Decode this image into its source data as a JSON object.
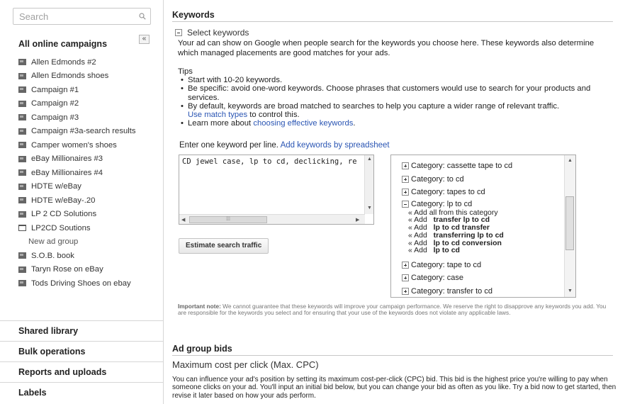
{
  "sidebar": {
    "search_placeholder": "Search",
    "all_campaigns_label": "All online campaigns",
    "collapse_label": "«",
    "campaigns": [
      "Allen Edmonds #2",
      "Allen Edmonds shoes",
      "Campaign #1",
      "Campaign #2",
      "Campaign #3",
      "Campaign #3a-search results",
      "Camper women's shoes",
      "eBay Millionaires #3",
      "eBay Millionaires #4",
      "HDTE w/eBay",
      "HDTE w/eBay-.20",
      "LP 2 CD Solutions",
      "LP2CD Soutions",
      "New ad group",
      "S.O.B. book",
      "Taryn Rose on eBay",
      "Tods Driving Shoes on ebay"
    ],
    "sections": [
      "Shared library",
      "Bulk operations",
      "Reports and uploads",
      "Labels"
    ]
  },
  "keywords": {
    "heading": "Keywords",
    "select_label": "Select keywords",
    "intro": "Your ad can show on Google when people search for the keywords you choose here. These keywords also determine which managed placements are good matches for your ads.",
    "tips_title": "Tips",
    "tip1": "Start with 10-20 keywords.",
    "tip2": "Be specific: avoid one-word keywords. Choose phrases that customers would use to search for your products and services.",
    "tip3a": "By default, keywords are broad matched to searches to help you capture a wider range of relevant traffic.",
    "tip3b_link": "Use match types",
    "tip3b_rest": " to control this.",
    "tip4_prefix": "Learn more about ",
    "tip4_link": "choosing effective keywords",
    "tip4_suffix": ".",
    "enter_prefix": "Enter one keyword per line. ",
    "enter_link": "Add keywords by spreadsheet",
    "textarea_value": "CD jewel case, lp to cd, declicking, re",
    "estimate_button": "Estimate search traffic",
    "categories": {
      "c1": "Category: cassette tape to cd",
      "c2": "Category: to cd",
      "c3": "Category: tapes to cd",
      "c4": "Category: lp to cd",
      "add_all": "« Add all from this category",
      "add1": "transfer lp to cd",
      "add2": "lp to cd transfer",
      "add3": "transferring lp to cd",
      "add4": "lp to cd conversion",
      "add5": "lp to cd",
      "add_label": "« Add",
      "c5": "Category: tape to cd",
      "c6": "Category: case",
      "c7": "Category: transfer to cd"
    },
    "important_label": "Important note:",
    "important_text": " We cannot guarantee that these keywords will improve your campaign performance. We reserve the right to disapprove any keywords you add. You are responsible for the keywords you select and for ensuring that your use of the keywords does not violate any applicable laws."
  },
  "bids": {
    "heading": "Ad group bids",
    "max_cpc_title": "Maximum cost per click (Max. CPC)",
    "description": "You can influence your ad's position by setting its maximum cost-per-click (CPC) bid. This bid is the highest price you're willing to pay when someone clicks on your ad. You'll input an initial bid below, but you can change your bid as often as you like. Try a bid now to get started, then revise it later based on how your ads perform."
  }
}
